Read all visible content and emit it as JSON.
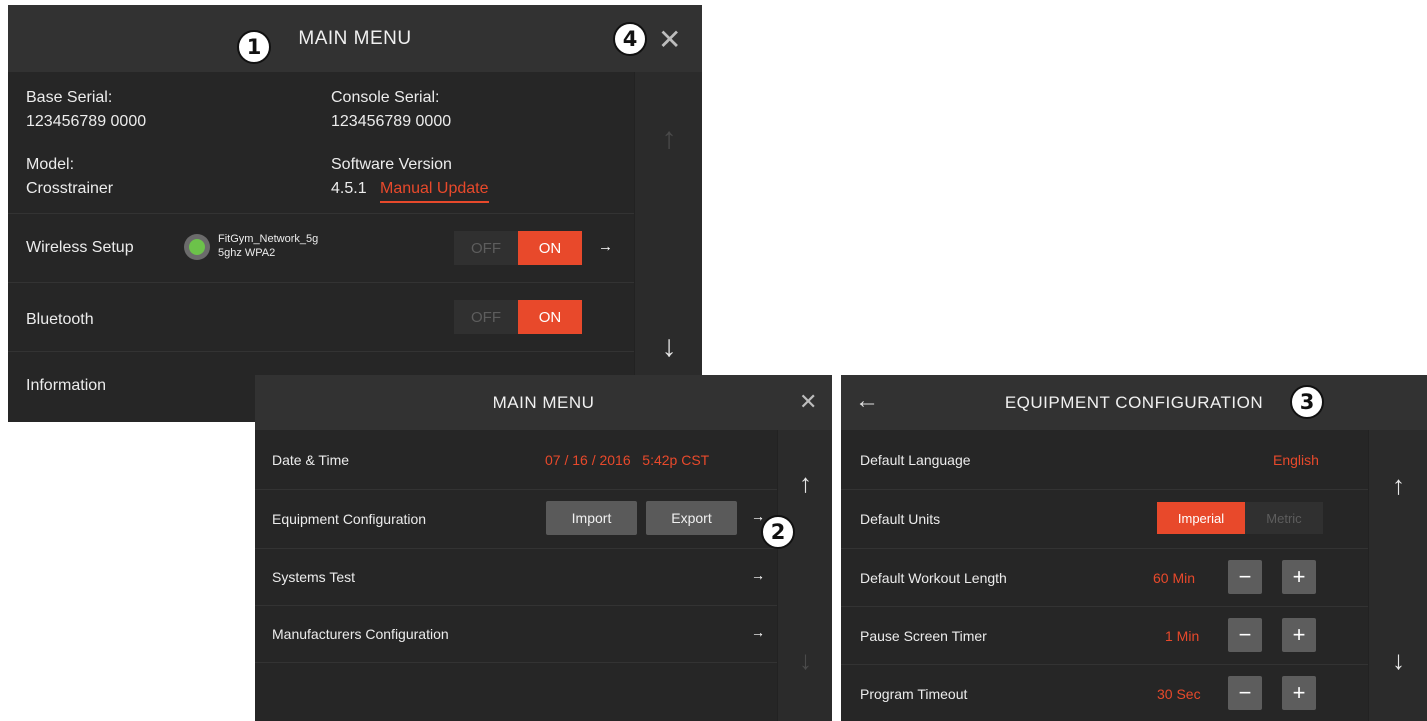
{
  "callouts": [
    "1",
    "2",
    "3",
    "4"
  ],
  "panel1": {
    "title": "MAIN MENU",
    "close_icon": "✕",
    "base_serial_label": "Base Serial:",
    "base_serial_value": "123456789 0000",
    "console_serial_label": "Console Serial:",
    "console_serial_value": "123456789 0000",
    "model_label": "Model:",
    "model_value": "Crosstrainer",
    "software_label": "Software Version",
    "software_value": "4.5.1",
    "manual_update": "Manual Update",
    "wireless_label": "Wireless Setup",
    "network_name": "FitGym_Network_5g",
    "network_detail": "5ghz WPA2",
    "bluetooth_label": "Bluetooth",
    "information_label": "Information",
    "off_label": "OFF",
    "on_label": "ON",
    "row_arrow": "→",
    "scroll_up": "↑",
    "scroll_down": "↓"
  },
  "panel2": {
    "title": "MAIN MENU",
    "close_icon": "✕",
    "date_time_label": "Date & Time",
    "date_time_value": "07 / 16 / 2016   5:42p CST",
    "equipment_label": "Equipment Configuration",
    "import_label": "Import",
    "export_label": "Export",
    "systems_test_label": "Systems Test",
    "manufacturers_label": "Manufacturers Configuration",
    "row_arrow": "→",
    "scroll_up": "↑",
    "scroll_down": "↓"
  },
  "panel3": {
    "back_icon": "←",
    "title": "EQUIPMENT CONFIGURATION",
    "language_label": "Default Language",
    "language_value": "English",
    "units_label": "Default Units",
    "imperial_label": "Imperial",
    "metric_label": "Metric",
    "workout_label": "Default Workout Length",
    "workout_value": "60 Min",
    "pause_label": "Pause Screen Timer",
    "pause_value": "1 Min",
    "timeout_label": "Program Timeout",
    "timeout_value": "30 Sec",
    "minus": "−",
    "plus": "+",
    "scroll_up": "↑",
    "scroll_down": "↓"
  },
  "colors": {
    "accent": "#e8492b",
    "panel_bg": "#262626",
    "header_bg": "#323232",
    "status_green": "#6cc24a"
  }
}
